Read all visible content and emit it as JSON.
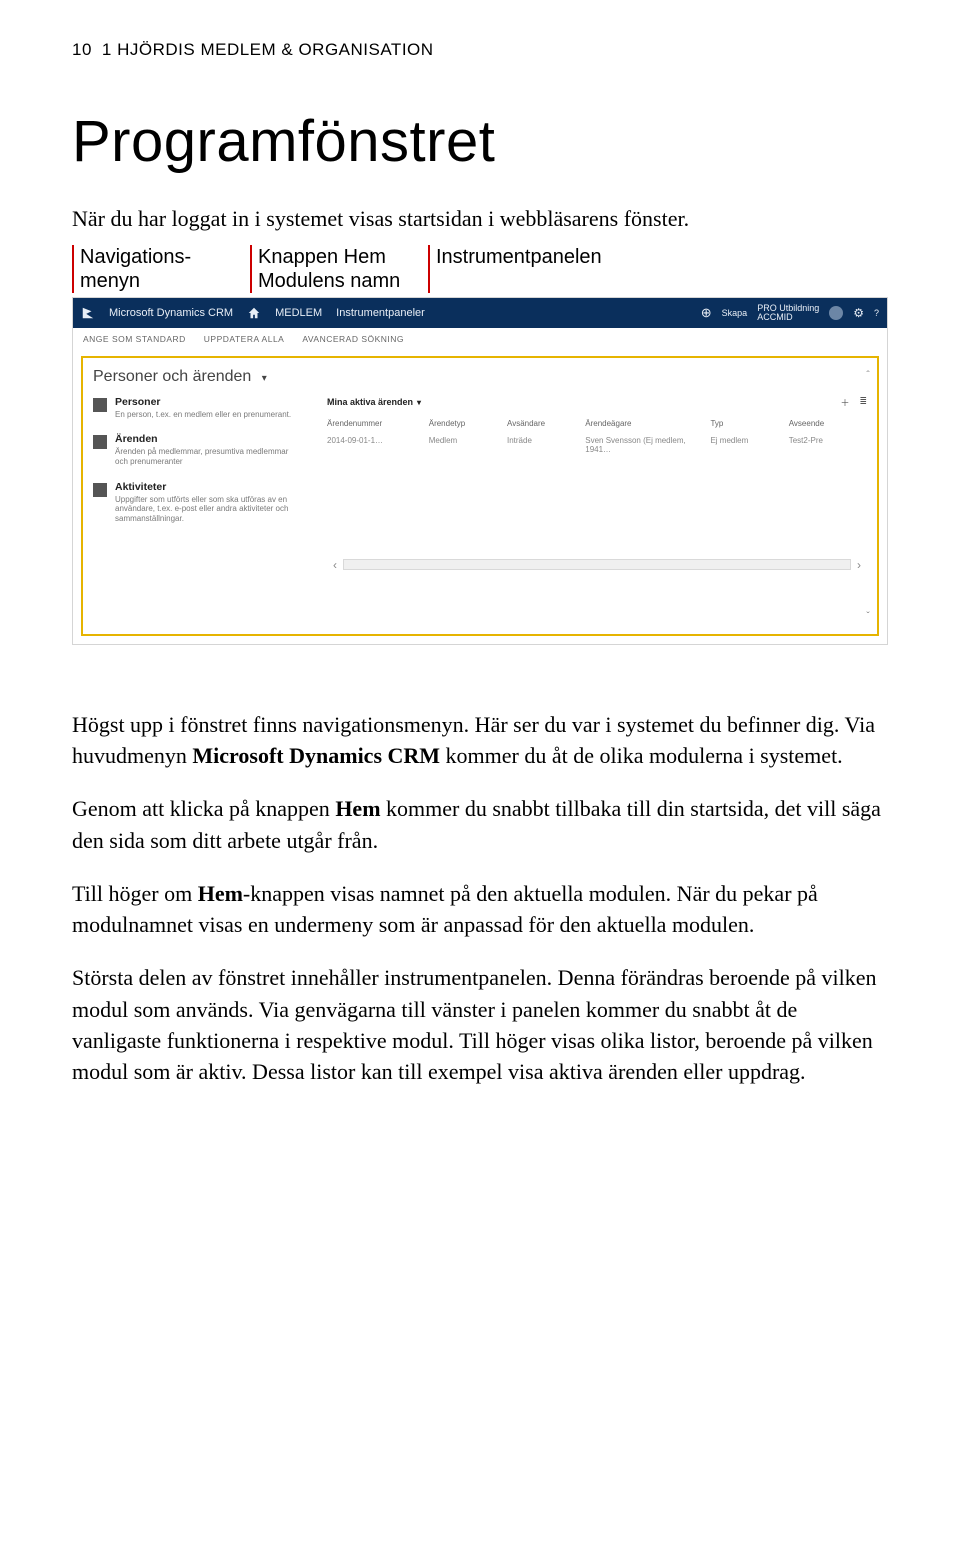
{
  "header": {
    "page_number": "10",
    "chapter": "1  HJÖRDIS MEDLEM & ORGANISATION"
  },
  "title": "Programfönstret",
  "intro": "När du har loggat in i systemet visas startsidan i webbläsarens fönster.",
  "callouts": {
    "nav_line1": "Navigations-",
    "nav_line2": "menyn",
    "hem_line1": "Knappen Hem",
    "hem_line2": "Modulens namn",
    "instr": "Instrumentpanelen"
  },
  "screenshot": {
    "brand": "Microsoft Dynamics CRM",
    "crumb1": "MEDLEM",
    "crumb2": "Instrumentpaneler",
    "skapa": "Skapa",
    "org_line1": "PRO Utbildning",
    "org_line2": "ACCMID",
    "cmdbar": {
      "c1": "ANGE SOM STANDARD",
      "c2": "UPPDATERA ALLA",
      "c3": "AVANCERAD SÖKNING"
    },
    "panel_title": "Personer och ärenden",
    "left": {
      "personer": {
        "title": "Personer",
        "desc": "En person, t.ex. en medlem eller en prenumerant."
      },
      "arenden": {
        "title": "Ärenden",
        "desc": "Ärenden på medlemmar, presumtiva medlemmar och prenumeranter"
      },
      "aktiviteter": {
        "title": "Aktiviteter",
        "desc": "Uppgifter som utförts eller som ska utföras av en användare, t.ex. e-post eller andra aktiviteter och sammanställningar."
      }
    },
    "grid": {
      "section_title": "Mina aktiva ärenden",
      "h1": "Ärendenummer",
      "h2": "Ärendetyp",
      "h3": "Avsändare",
      "h4": "Ärendeägare",
      "h5": "Typ",
      "h6": "Avseende",
      "r1": "2014-09-01-1…",
      "r2": "Medlem",
      "r3": "Inträde",
      "r4": "Sven Svensson (Ej medlem, 1941…",
      "r5": "Ej medlem",
      "r6": "Test2-Pre"
    }
  },
  "body": {
    "p1a": "Högst upp i fönstret finns navigationsmenyn. Här ser du var i systemet du befinner dig. Via huvudmenyn ",
    "p1b": "Microsoft Dynamics CRM",
    "p1c": " kommer du åt de olika modulerna i systemet.",
    "p2a": "Genom att klicka på knappen ",
    "p2b": "Hem",
    "p2c": " kommer du snabbt tillbaka till din startsida, det vill säga den sida som ditt arbete utgår från.",
    "p3a": "Till höger om ",
    "p3b": "Hem",
    "p3c": "-knappen visas namnet på den aktuella modulen. När du pekar på modulnamnet visas en undermeny som är anpassad för den aktuella modulen.",
    "p4": "Största delen av fönstret innehåller instrumentpanelen. Denna förändras beroende på vilken modul som används. Via genvägarna till vänster i panelen kommer du snabbt åt de vanligaste funktionerna i respektive modul. Till höger visas olika listor, beroende på vilken modul som är aktiv. Dessa listor kan till exempel visa aktiva ärenden eller uppdrag."
  }
}
